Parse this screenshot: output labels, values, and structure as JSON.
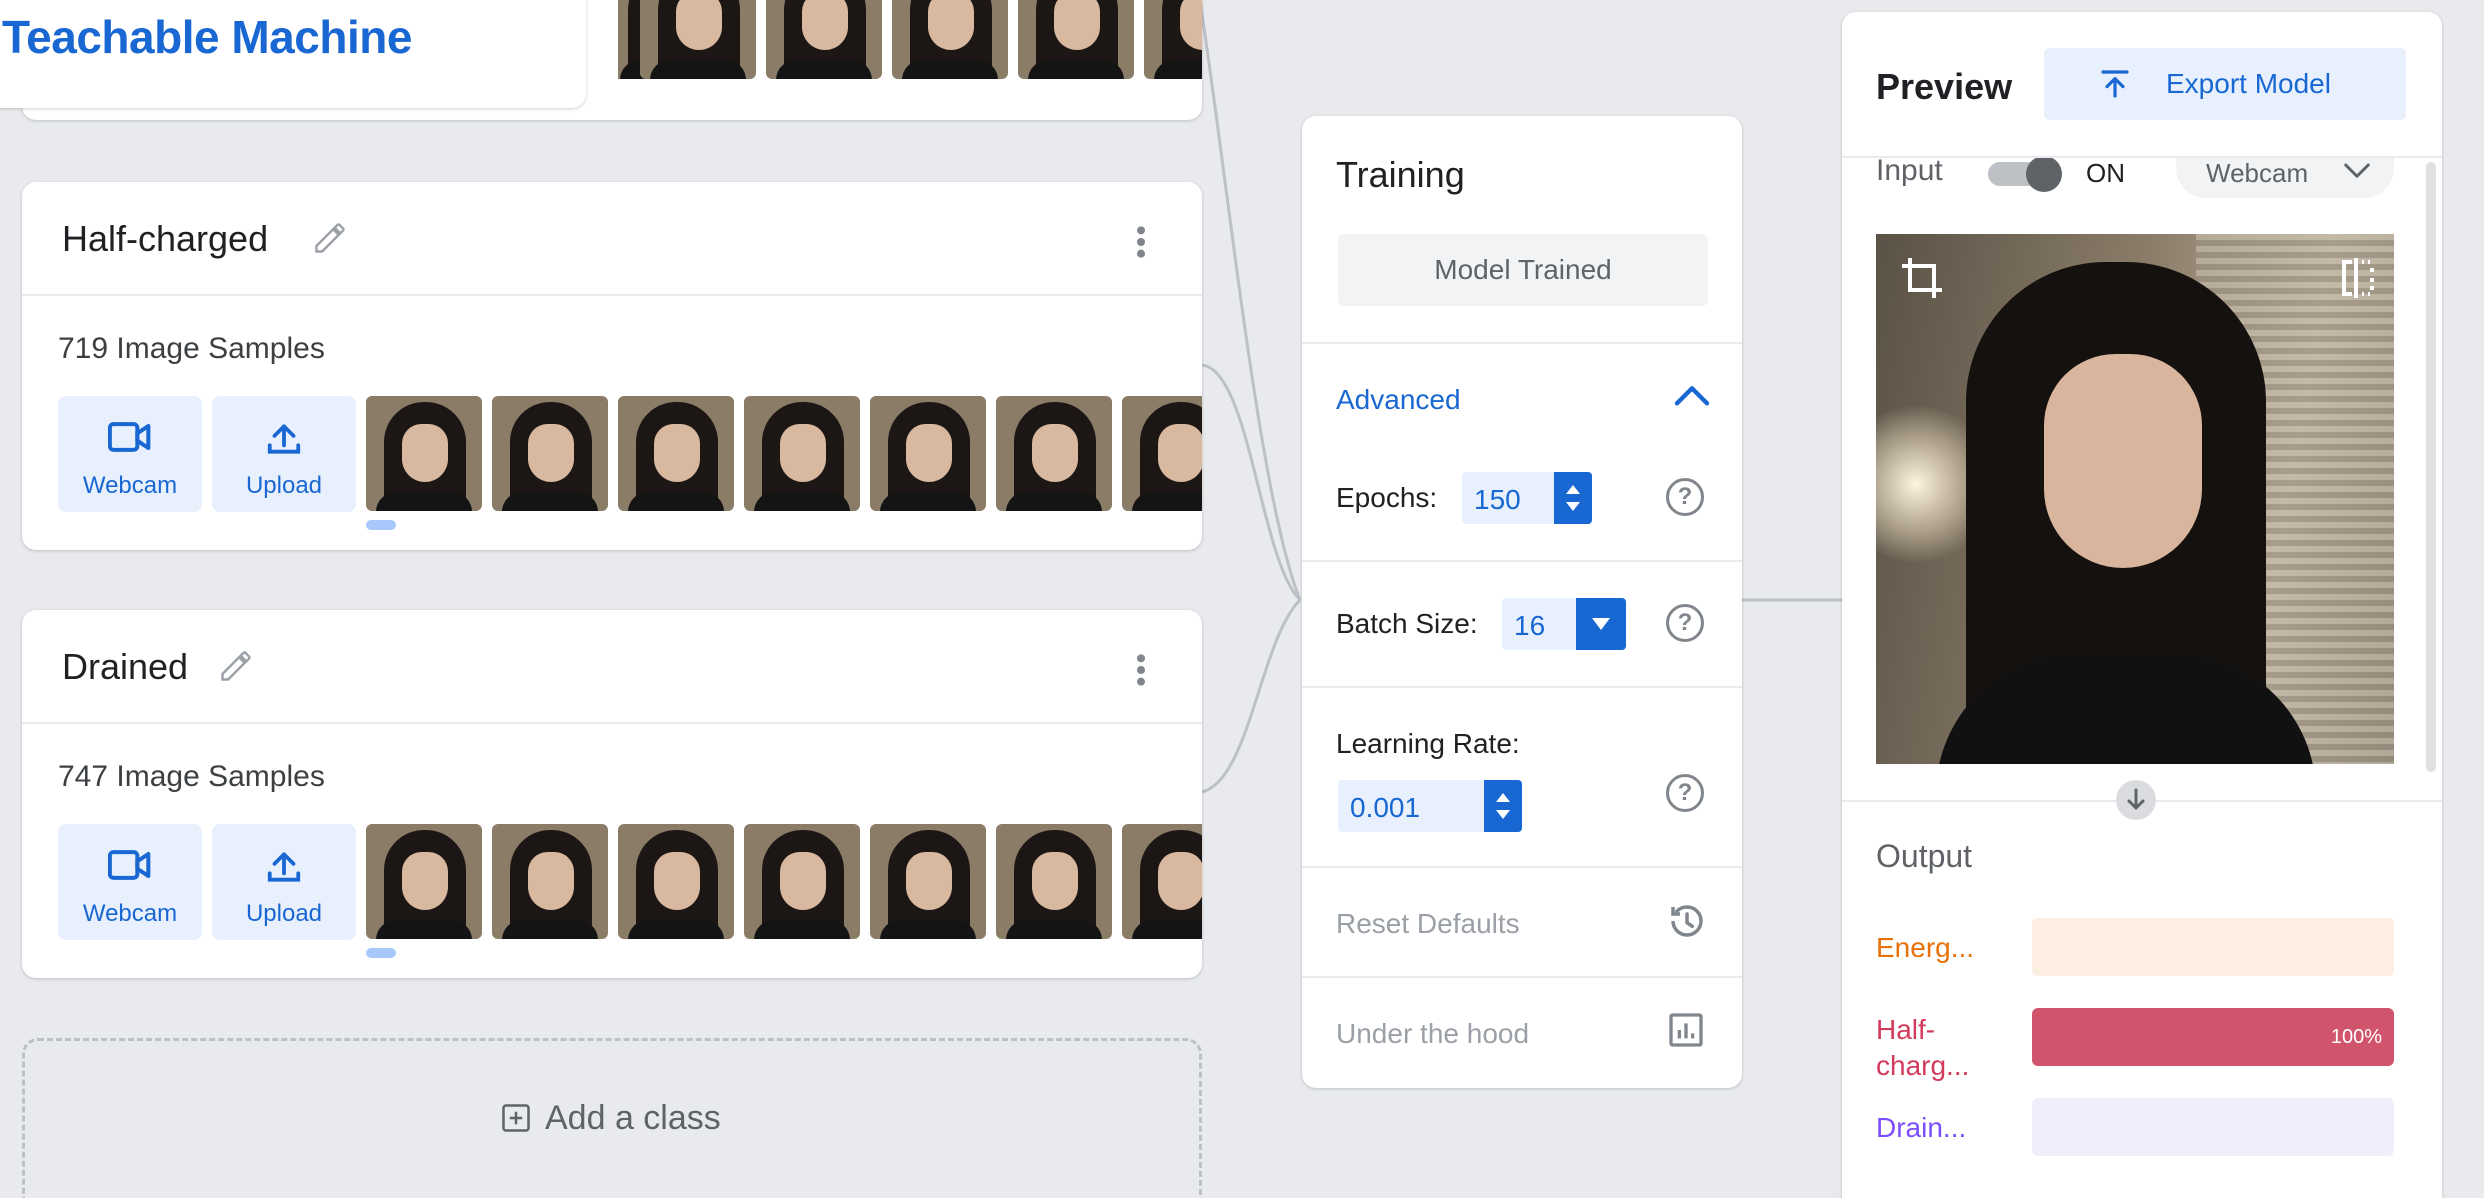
{
  "app": {
    "title": "Teachable Machine"
  },
  "classes": [
    {
      "name": "Half-charged",
      "samples_label": "719 Image Samples",
      "webcam_label": "Webcam",
      "upload_label": "Upload"
    },
    {
      "name": "Drained",
      "samples_label": "747 Image Samples",
      "webcam_label": "Webcam",
      "upload_label": "Upload"
    }
  ],
  "add_class": {
    "label": "Add a class"
  },
  "training": {
    "title": "Training",
    "status_button": "Model Trained",
    "advanced_label": "Advanced",
    "epochs_label": "Epochs:",
    "epochs_value": "150",
    "batch_label": "Batch Size:",
    "batch_value": "16",
    "lr_label": "Learning Rate:",
    "lr_value": "0.001",
    "reset_label": "Reset Defaults",
    "hood_label": "Under the hood"
  },
  "preview": {
    "title": "Preview",
    "export_label": "Export Model",
    "input_label": "Input",
    "toggle_label": "ON",
    "source_label": "Webcam",
    "output_label": "Output",
    "outputs": [
      {
        "label": "Energ...",
        "color": "#e8710a",
        "bar_bg": "#fdeee2",
        "value": 0,
        "value_label": ""
      },
      {
        "label": "Half-\ncharg...",
        "color": "#d33b5c",
        "bar_bg": "#d1546d",
        "value": 100,
        "value_label": "100%"
      },
      {
        "label": "Drain...",
        "color": "#7c4dff",
        "bar_bg": "#efeefb",
        "value": 0,
        "value_label": ""
      }
    ]
  },
  "colors": {
    "accent": "#1967d2",
    "accent_light": "#e8f0fe",
    "background": "#e8eaed"
  }
}
